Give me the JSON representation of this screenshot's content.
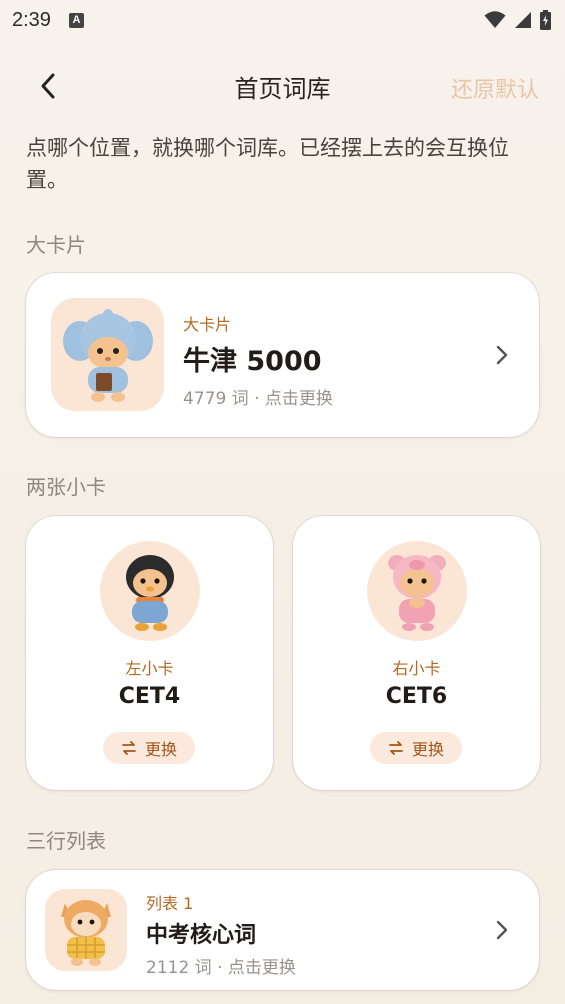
{
  "status": {
    "time": "2:39",
    "notif_icon": "A"
  },
  "header": {
    "title": "首页词库",
    "reset_label": "还原默认"
  },
  "description": "点哪个位置，就换哪个词库。已经摆上去的会互换位置。",
  "big_section": {
    "label": "大卡片",
    "card": {
      "kicker": "大卡片",
      "title": "牛津 5000",
      "meta": "4779 词 · 点击更换",
      "mascot": "elephant-costume-hamster"
    }
  },
  "small_section": {
    "label": "两张小卡",
    "left": {
      "kicker": "左小卡",
      "title": "CET4",
      "swap_label": "更换",
      "mascot": "penguin-costume-hamster"
    },
    "right": {
      "kicker": "右小卡",
      "title": "CET6",
      "swap_label": "更换",
      "mascot": "pig-costume-hamster"
    }
  },
  "list_section": {
    "label": "三行列表",
    "items": [
      {
        "kicker": "列表 1",
        "title": "中考核心词",
        "meta": "2112 词 · 点击更换",
        "mascot": "shiba-costume-hamster"
      }
    ]
  },
  "colors": {
    "accent": "#b36a22",
    "reset": "#e7c6a6",
    "thumb_bg": "#fbe6d6",
    "swap_bg": "#fbe9dd"
  }
}
